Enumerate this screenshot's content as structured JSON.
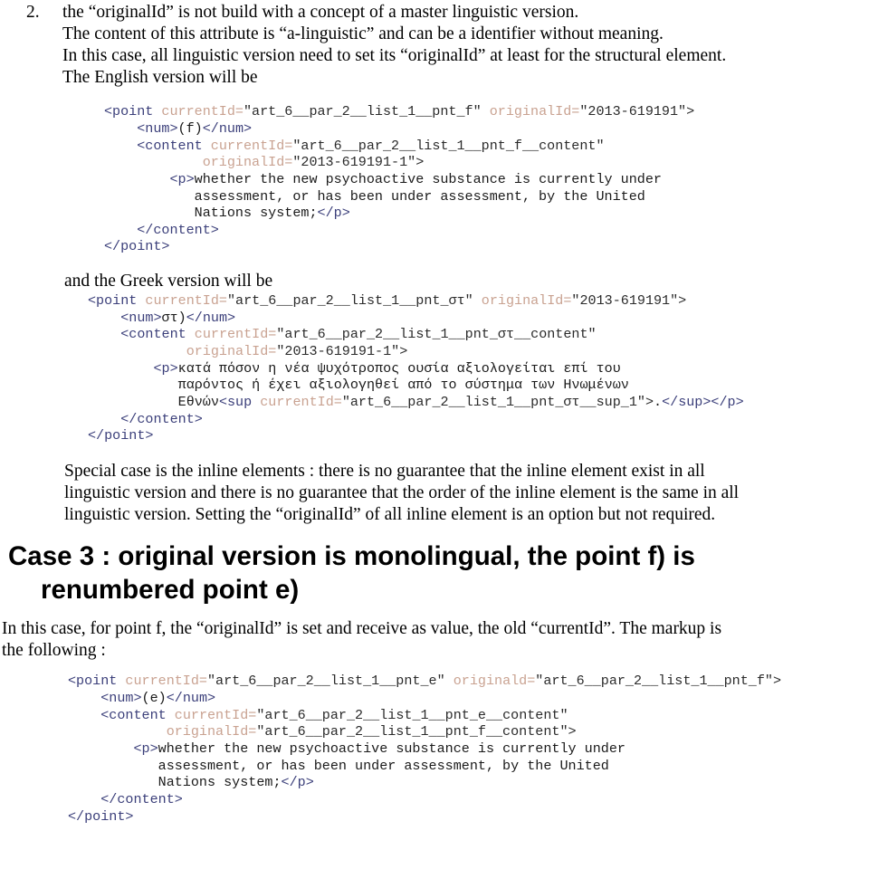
{
  "list_item": {
    "marker": "2.",
    "lines": [
      "the “originalId” is not build with a concept of a master linguistic version.",
      "The content of this attribute is “a-linguistic” and can be a identifier without meaning.",
      "In this case, all linguistic version need to set its “originalId” at least for the structural element.",
      "The English version will be"
    ]
  },
  "code_block_english": {
    "lines": [
      [
        {
          "t": "tag",
          "s": "<point "
        },
        {
          "t": "attr",
          "s": "currentId="
        },
        {
          "t": "val",
          "s": "\"art_6__par_2__list_1__pnt_f\" "
        },
        {
          "t": "attr",
          "s": "originalId="
        },
        {
          "t": "val",
          "s": "\"2013-619191\">"
        }
      ],
      [
        {
          "t": "tag",
          "s": "    <num>"
        },
        {
          "t": "txt",
          "s": "(f)"
        },
        {
          "t": "tag",
          "s": "</num>"
        }
      ],
      [
        {
          "t": "tag",
          "s": "    <content "
        },
        {
          "t": "attr",
          "s": "currentId="
        },
        {
          "t": "val",
          "s": "\"art_6__par_2__list_1__pnt_f__content\""
        }
      ],
      [
        {
          "t": "attr",
          "s": "            originalId="
        },
        {
          "t": "val",
          "s": "\"2013-619191-1\">"
        }
      ],
      [
        {
          "t": "tag",
          "s": "        <p>"
        },
        {
          "t": "txt",
          "s": "whether the new psychoactive substance is currently under"
        }
      ],
      [
        {
          "t": "txt",
          "s": "           assessment, or has been under assessment, by the United"
        }
      ],
      [
        {
          "t": "txt",
          "s": "           Nations system;"
        },
        {
          "t": "tag",
          "s": "</p>"
        }
      ],
      [
        {
          "t": "tag",
          "s": "    </content>"
        }
      ],
      [
        {
          "t": "tag",
          "s": "</point>"
        }
      ]
    ]
  },
  "greek_lead": "and the Greek version will be",
  "code_block_greek": {
    "lines": [
      [
        {
          "t": "tag",
          "s": "<point "
        },
        {
          "t": "attr",
          "s": "currentId="
        },
        {
          "t": "val",
          "s": "\"art_6__par_2__list_1__pnt_στ\" "
        },
        {
          "t": "attr",
          "s": "originalId="
        },
        {
          "t": "val",
          "s": "\"2013-619191\">"
        }
      ],
      [
        {
          "t": "tag",
          "s": "    <num>"
        },
        {
          "t": "txt",
          "s": "στ)"
        },
        {
          "t": "tag",
          "s": "</num>"
        }
      ],
      [
        {
          "t": "tag",
          "s": "    <content "
        },
        {
          "t": "attr",
          "s": "currentId="
        },
        {
          "t": "val",
          "s": "\"art_6__par_2__list_1__pnt_στ__content\""
        }
      ],
      [
        {
          "t": "attr",
          "s": "            originalId="
        },
        {
          "t": "val",
          "s": "\"2013-619191-1\">"
        }
      ],
      [
        {
          "t": "tag",
          "s": "        <p>"
        },
        {
          "t": "txt",
          "s": "κατά πόσον η νέα ψυχότροπος ουσία αξιολογείται επί του"
        }
      ],
      [
        {
          "t": "txt",
          "s": "           παρόντος ή έχει αξιολογηθεί από το σύστημα των Ηνωμένων"
        }
      ],
      [
        {
          "t": "txt",
          "s": "           Εθνών"
        },
        {
          "t": "tag",
          "s": "<sup "
        },
        {
          "t": "attr",
          "s": "currentId="
        },
        {
          "t": "val",
          "s": "\"art_6__par_2__list_1__pnt_στ__sup_1\">"
        },
        {
          "t": "txt",
          "s": "."
        },
        {
          "t": "tag",
          "s": "</sup></p>"
        }
      ],
      [
        {
          "t": "tag",
          "s": "    </content>"
        }
      ],
      [
        {
          "t": "tag",
          "s": "</point>"
        }
      ]
    ]
  },
  "special_case_paragraph": {
    "lines": [
      "Special case is the inline elements : there is no guarantee that the inline element exist in all",
      "linguistic version and there is no guarantee that the order of the inline element is the same in all",
      "linguistic version.  Setting the “originalId” of all inline element is an option but not required."
    ]
  },
  "case3_heading": {
    "line1": "Case 3 : original version is monolingual, the point f) is",
    "line2": "renumbered point e)"
  },
  "case3_intro": {
    "lines": [
      "In this case, for point f, the “originalId” is set and receive as value, the old “currentId”.  The markup is",
      "the following :"
    ]
  },
  "code_block_case3": {
    "lines": [
      [
        {
          "t": "tag",
          "s": "<point "
        },
        {
          "t": "attr",
          "s": "currentId="
        },
        {
          "t": "val",
          "s": "\"art_6__par_2__list_1__pnt_e\" "
        },
        {
          "t": "attr",
          "s": "originald="
        },
        {
          "t": "val",
          "s": "\"art_6__par_2__list_1__pnt_f\">"
        }
      ],
      [
        {
          "t": "tag",
          "s": "    <num>"
        },
        {
          "t": "txt",
          "s": "(e)"
        },
        {
          "t": "tag",
          "s": "</num>"
        }
      ],
      [
        {
          "t": "tag",
          "s": "    <content "
        },
        {
          "t": "attr",
          "s": "currentId="
        },
        {
          "t": "val",
          "s": "\"art_6__par_2__list_1__pnt_e__content\""
        }
      ],
      [
        {
          "t": "attr",
          "s": "            originalId="
        },
        {
          "t": "val",
          "s": "\"art_6__par_2__list_1__pnt_f__content\">"
        }
      ],
      [
        {
          "t": "tag",
          "s": "        <p>"
        },
        {
          "t": "txt",
          "s": "whether the new psychoactive substance is currently under"
        }
      ],
      [
        {
          "t": "txt",
          "s": "           assessment, or has been under assessment, by the United"
        }
      ],
      [
        {
          "t": "txt",
          "s": "           Nations system;"
        },
        {
          "t": "tag",
          "s": "</p>"
        }
      ],
      [
        {
          "t": "tag",
          "s": "    </content>"
        }
      ],
      [
        {
          "t": "tag",
          "s": "</point>"
        }
      ]
    ]
  },
  "colors": {
    "tag": "#3b3f7a",
    "attribute_name": "#c9a291",
    "attribute_value": "#2b2b2b",
    "text": "#1a1a1a",
    "background": "#ffffff"
  }
}
